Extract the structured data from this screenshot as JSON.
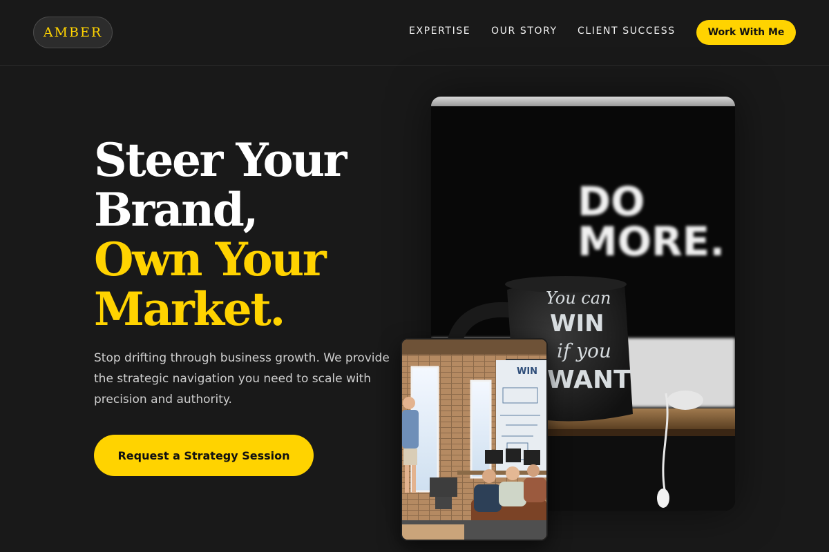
{
  "header": {
    "logo_text": "AMBER",
    "nav": [
      "EXPERTISE",
      "OUR STORY",
      "CLIENT SUCCESS"
    ],
    "cta_label": "Work With Me"
  },
  "hero": {
    "headline_lines": [
      "Steer Your",
      "Brand,"
    ],
    "headline_accent_lines": [
      "Own Your",
      "Market."
    ],
    "subtext": "Stop drifting through business growth. We provide the strategic navigation you need to scale with precision and authority.",
    "cta_label": "Request a Strategy Session"
  },
  "images": {
    "main": {
      "poster_text_lines": [
        "DO",
        "MORE."
      ],
      "mug_text_lines": [
        "You can",
        "WIN",
        "if you",
        "WANT"
      ]
    },
    "small": {
      "sign_text": "WIN"
    }
  },
  "colors": {
    "background": "#191919",
    "accent": "#ffd300",
    "text": "#ffffff"
  }
}
